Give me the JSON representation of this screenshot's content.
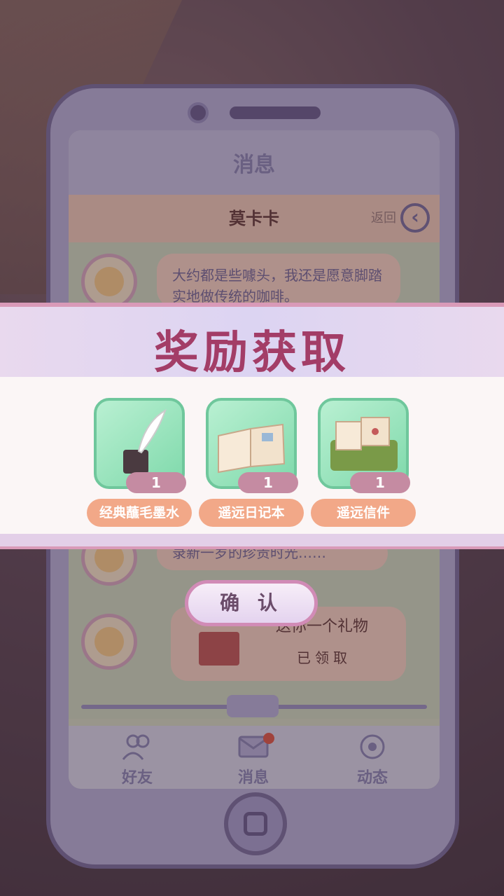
{
  "screen": {
    "title": "消息",
    "contact_name": "莫卡卡",
    "back_label": "返回"
  },
  "chat": {
    "messages": [
      {
        "text": "大约都是些噱头，我还是愿意脚踏实地做传统的咖啡。"
      },
      {
        "text": "录新一岁的珍贵时光……"
      },
      {
        "text": "送你一个礼物",
        "status": "已领取"
      }
    ]
  },
  "nav": {
    "items": [
      {
        "label": "好友",
        "icon": "friends-icon"
      },
      {
        "label": "消息",
        "icon": "message-icon"
      },
      {
        "label": "动态",
        "icon": "moments-icon"
      }
    ]
  },
  "reward": {
    "title": "奖励获取",
    "items": [
      {
        "name": "经典蘸毛墨水",
        "count": "1",
        "icon": "ink-quill-icon"
      },
      {
        "name": "遥远日记本",
        "count": "1",
        "icon": "diary-icon"
      },
      {
        "name": "遥远信件",
        "count": "1",
        "icon": "letters-box-icon"
      }
    ],
    "confirm_label": "确 认"
  },
  "colors": {
    "reward_title": "#a33d67",
    "item_card": "#7fd9ab",
    "item_name_bg": "#f2a888",
    "count_badge": "#c58ba2"
  }
}
